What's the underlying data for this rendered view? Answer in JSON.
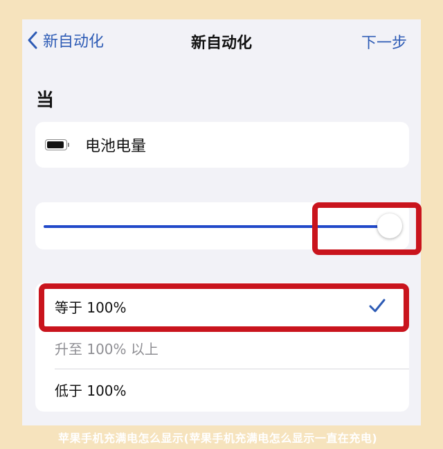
{
  "nav": {
    "back_label": "新自动化",
    "title": "新自动化",
    "next_label": "下一步"
  },
  "section": {
    "heading": "当"
  },
  "trigger": {
    "icon": "battery-icon",
    "label": "电池电量"
  },
  "slider": {
    "value_percent": 100,
    "track_color": "#2149c9"
  },
  "options": [
    {
      "label": "等于 100%",
      "selected": true,
      "enabled": true
    },
    {
      "label": "升至 100% 以上",
      "selected": false,
      "enabled": false
    },
    {
      "label": "低于 100%",
      "selected": false,
      "enabled": true
    }
  ],
  "caption": "苹果手机充满电怎么显示(苹果手机充满电怎么显示一直在充电)",
  "colors": {
    "accent": "#2d5bb5",
    "highlight": "#c9141d",
    "background": "#f6e3bd"
  }
}
